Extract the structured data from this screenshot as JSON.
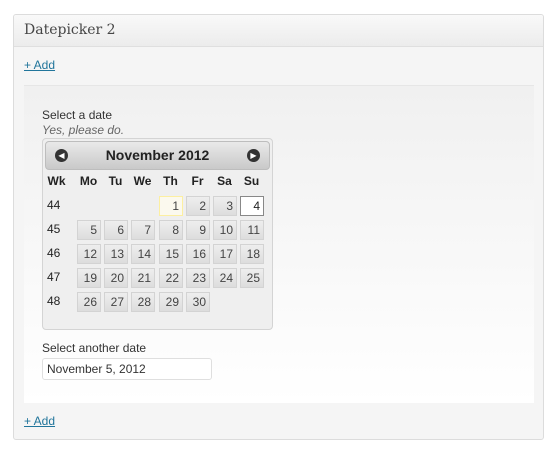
{
  "panel": {
    "title": "Datepicker 2"
  },
  "actions": {
    "add_top": "+ Add",
    "add_bottom": "+ Add"
  },
  "field1": {
    "label": "Select a date",
    "description": "Yes, please do."
  },
  "calendar": {
    "month": "November",
    "year": "2012",
    "prev_icon": "chevron-left-icon",
    "next_icon": "chevron-right-icon",
    "headers": [
      "Wk",
      "Mo",
      "Tu",
      "We",
      "Th",
      "Fr",
      "Sa",
      "Su"
    ],
    "weeks": [
      {
        "wk": "44",
        "days": [
          "",
          "",
          "",
          "1",
          "2",
          "3",
          "4"
        ]
      },
      {
        "wk": "45",
        "days": [
          "5",
          "6",
          "7",
          "8",
          "9",
          "10",
          "11"
        ]
      },
      {
        "wk": "46",
        "days": [
          "12",
          "13",
          "14",
          "15",
          "16",
          "17",
          "18"
        ]
      },
      {
        "wk": "47",
        "days": [
          "19",
          "20",
          "21",
          "22",
          "23",
          "24",
          "25"
        ]
      },
      {
        "wk": "48",
        "days": [
          "26",
          "27",
          "28",
          "29",
          "30",
          "",
          ""
        ]
      }
    ],
    "today": "1",
    "selected": "4"
  },
  "field2": {
    "label": "Select another date",
    "value": "November 5, 2012"
  },
  "colors": {
    "link": "#21759b",
    "today_bg": "#fbf9ee",
    "selected_border": "#888888"
  }
}
